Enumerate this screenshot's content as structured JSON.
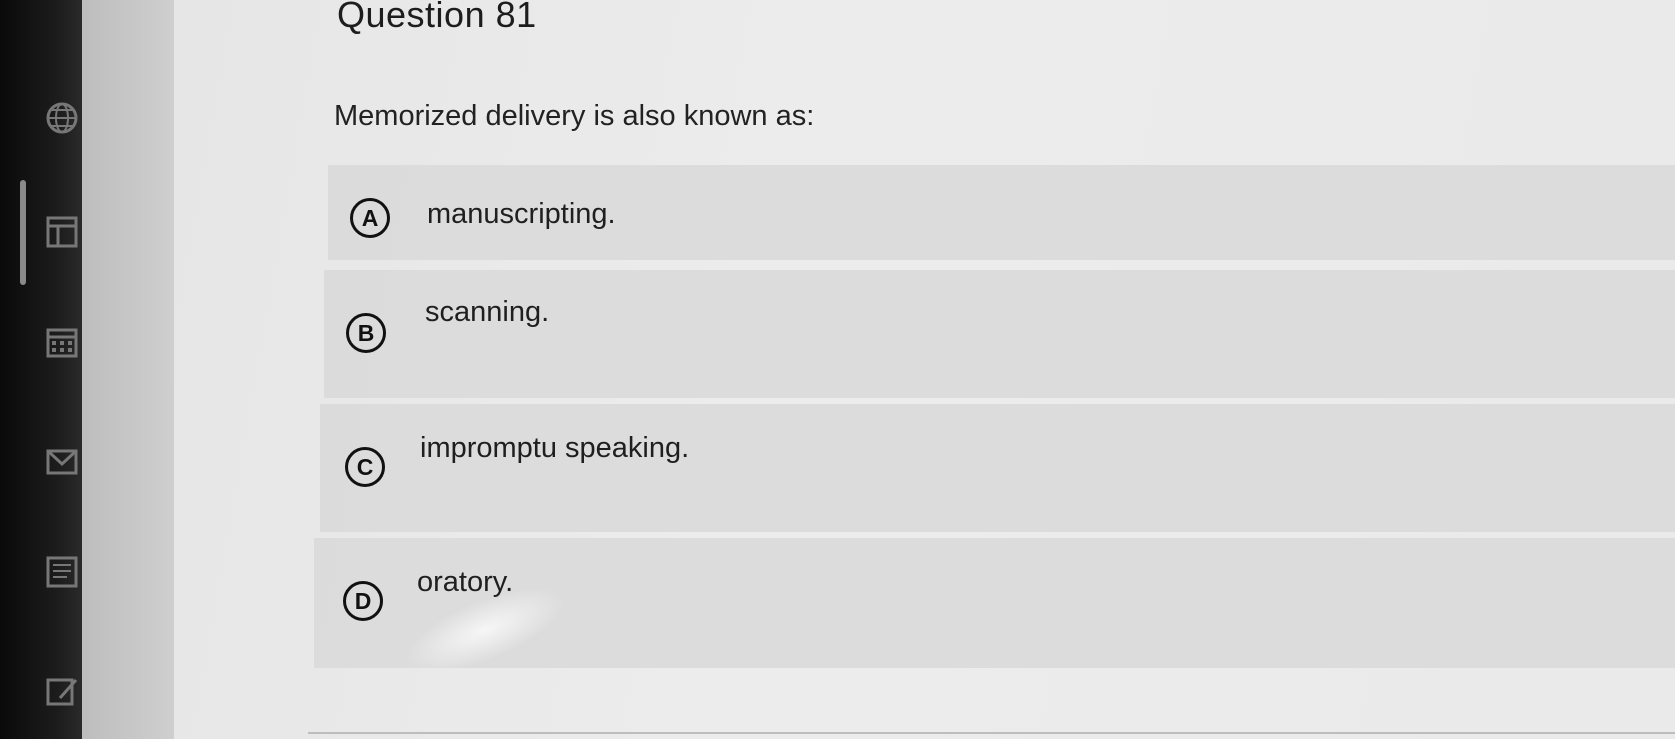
{
  "question": {
    "title": "Question 81",
    "prompt": "Memorized delivery is also known as:"
  },
  "options": [
    {
      "letter": "A",
      "text": "manuscripting."
    },
    {
      "letter": "B",
      "text": "scanning."
    },
    {
      "letter": "C",
      "text": "impromptu speaking."
    },
    {
      "letter": "D",
      "text": "oratory."
    }
  ],
  "sidebar": {
    "icons": [
      "globe-icon",
      "gradebook-icon",
      "calendar-icon",
      "inbox-icon",
      "notes-icon",
      "edit-icon"
    ]
  },
  "colors": {
    "rail": "#141414",
    "panel": "#ebebeb",
    "option_bg": "#d7d7d7",
    "text": "#1f1f1f"
  }
}
